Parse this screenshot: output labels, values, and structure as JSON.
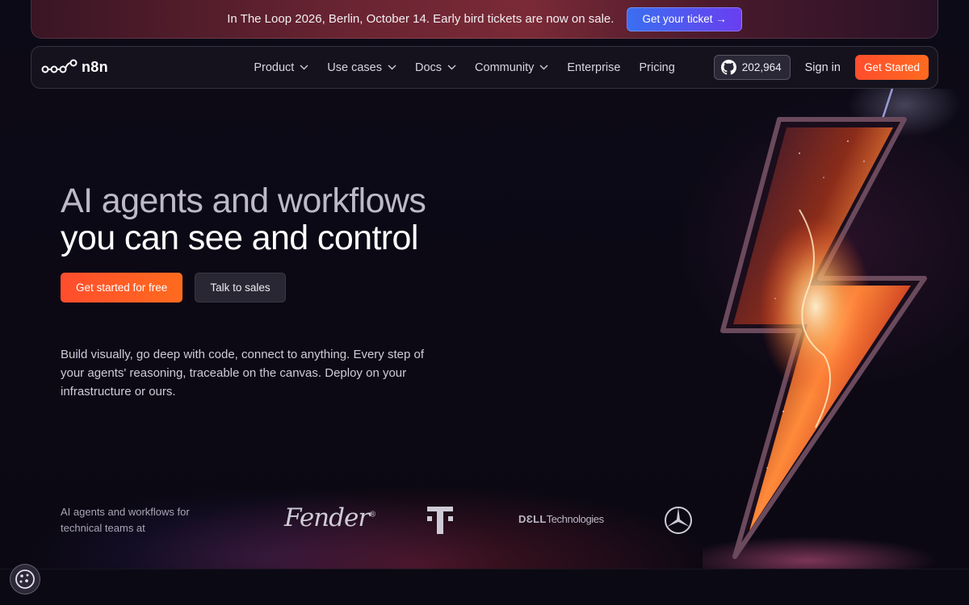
{
  "banner": {
    "text": "In The Loop 2026, Berlin, October 14. Early bird tickets are now on sale.",
    "button_label": "Get your ticket →"
  },
  "nav": {
    "logo_text": "n8n",
    "links": [
      {
        "label": "Product",
        "has_dropdown": true
      },
      {
        "label": "Use cases",
        "has_dropdown": true
      },
      {
        "label": "Docs",
        "has_dropdown": true
      },
      {
        "label": "Community",
        "has_dropdown": true
      },
      {
        "label": "Enterprise",
        "has_dropdown": false
      },
      {
        "label": "Pricing",
        "has_dropdown": false
      }
    ],
    "github_stars": "202,964",
    "sign_in_label": "Sign in",
    "get_started_label": "Get Started"
  },
  "hero": {
    "title_line1": "AI agents and workflows",
    "title_line2": "you can see and control",
    "primary_cta": "Get started for free",
    "secondary_cta": "Talk to sales",
    "description": "Build visually, go deep with code, connect to anything. Every step of your agents' reasoning, traceable on the canvas. Deploy on your infrastructure or ours."
  },
  "logos": {
    "caption": "AI agents and workflows for technical teams at",
    "fender": "Fender",
    "dell_brand": "DƐLL",
    "dell_suffix": "Technologies"
  },
  "icons": {
    "logo": "n8n-nodes-logo-icon",
    "github": "github-icon",
    "chevron": "chevron-down-icon",
    "cookie": "cookie-icon",
    "art": "lightning-bolt-art"
  },
  "colors": {
    "accent_orange": "#ff5a26",
    "banner_button": "#4f5cf0",
    "background": "#0d0a17"
  }
}
